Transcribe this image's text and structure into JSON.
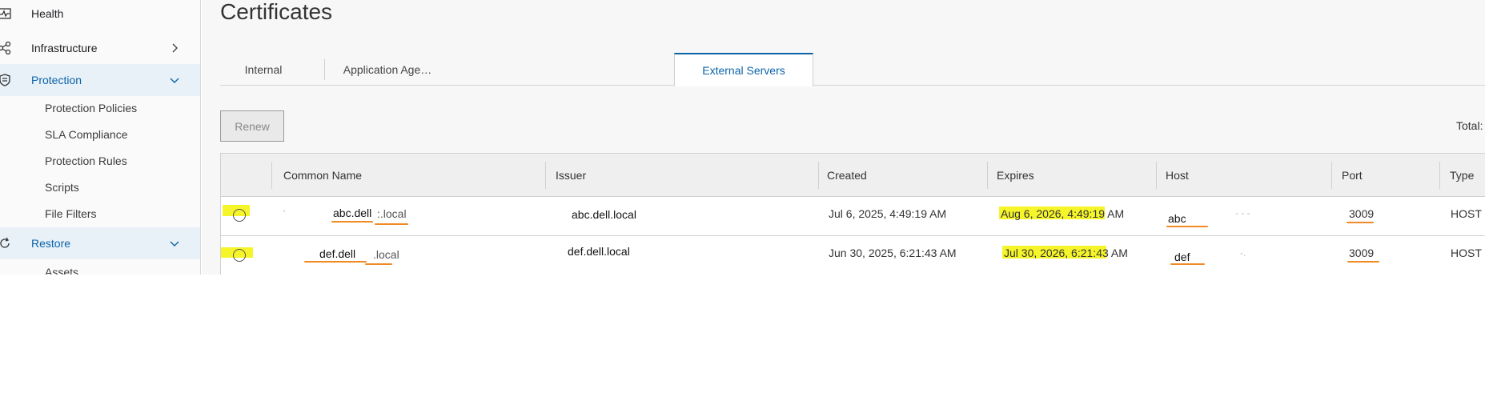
{
  "sidebar": {
    "items": [
      {
        "label": "Health",
        "icon": "pulse-icon"
      },
      {
        "label": "Infrastructure",
        "icon": "network-icon"
      },
      {
        "label": "Protection",
        "icon": "shield-icon"
      },
      {
        "label": "Restore",
        "icon": "restore-icon"
      }
    ],
    "protection_children": [
      "Protection Policies",
      "SLA Compliance",
      "Protection Rules",
      "Scripts",
      "File Filters"
    ],
    "restore_children": [
      "Assets"
    ]
  },
  "page": {
    "title": "Certificates",
    "tabs": [
      "Internal",
      "Application Age…",
      "External Servers"
    ],
    "selected_tab": "External Servers",
    "renew_label": "Renew",
    "total_label": "Total:"
  },
  "table": {
    "columns": [
      "Common Name",
      "Issuer",
      "Created",
      "Expires",
      "Host",
      "Port",
      "Type"
    ],
    "rows": [
      {
        "common_name_a": "abc.dell",
        "common_name_b": ":.local",
        "issuer": "abc.dell.local",
        "created": "Jul 6, 2025, 4:49:19 AM",
        "expires": "Aug 6, 2026, 4:49:19 AM",
        "host": "abc",
        "port": "3009",
        "type": "HOST"
      },
      {
        "common_name_a": "def.dell",
        "common_name_b": ".local",
        "issuer": "def.dell.local",
        "created": "Jun 30, 2025, 6:21:43 AM",
        "expires": "Jul 30, 2026, 6:21:43 AM",
        "host": "def",
        "port": "3009",
        "type": "HOST"
      }
    ]
  },
  "colors": {
    "accent": "#0b63a8",
    "highlight": "#f5f52a",
    "annotation": "#f08a24"
  }
}
